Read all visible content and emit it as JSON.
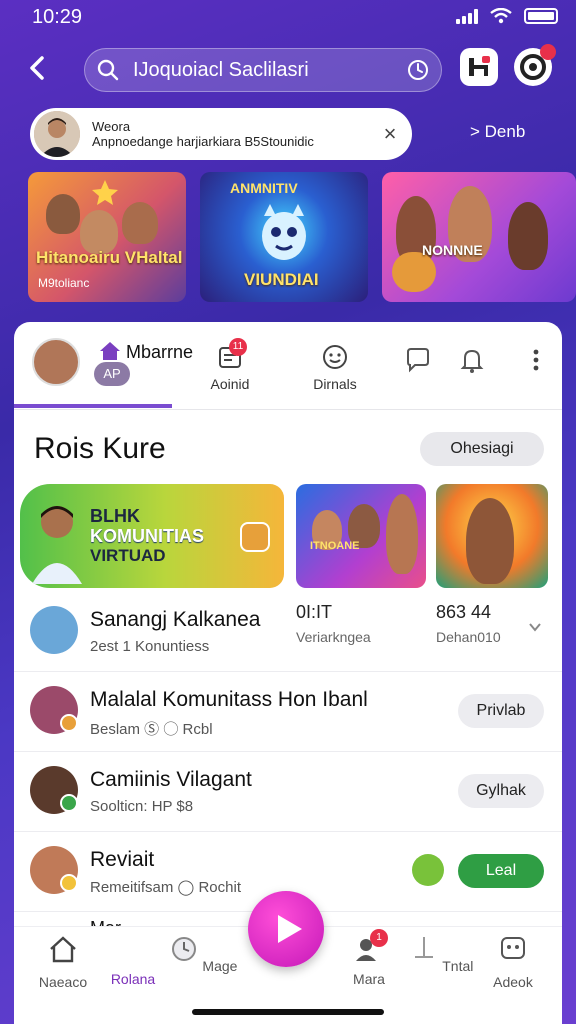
{
  "status": {
    "time": "10:29"
  },
  "search": {
    "query": "IJoquoiacl Saclilasri"
  },
  "notification": {
    "line1": "Weora",
    "line2": "Anpnoedange harjiarkiara B5Stounidic",
    "link": "> Denb"
  },
  "carousel": [
    {
      "label": "Hitanoairu VHaltal",
      "sub": "M9tolianc"
    },
    {
      "label": "VIUNDIAI",
      "title": "ANMNITIV"
    },
    {
      "label": "NONNNE"
    }
  ],
  "profile": {
    "name": "Mbarrne",
    "badge": "AP",
    "tabs": [
      {
        "label": "Aoinid",
        "count": "11"
      },
      {
        "label": "Dirnals"
      }
    ]
  },
  "section": {
    "title": "Rois Kure",
    "action": "Ohesiagi"
  },
  "feature": {
    "title": "BLHK",
    "sub1": "KOMUNITIAS",
    "sub2": "VIRTUAD",
    "small_label": "ITNOANE"
  },
  "list": [
    {
      "title": "Sanangj Kalkanea",
      "sub": "2est 1 Konuntiess",
      "stat1": "0I:IT",
      "stat1_sub": "Veriarkngea",
      "stat2": "863 44",
      "stat2_sub": "Dehan010"
    },
    {
      "title": "Malalal Komunitass Hon Ibanl",
      "sub": "Beslam  Ⓢ  ◯ Rcbl",
      "button": "Privlab"
    },
    {
      "title": "Camiinis Vilagant",
      "sub": "Soolticn: HP $8",
      "button": "Gylhak"
    },
    {
      "title": "Reviait",
      "sub": "Remeitifsam  ◯ Rochit",
      "button": "Leal"
    }
  ],
  "peek": {
    "title": "Mar"
  },
  "nav": [
    {
      "label": "Naeaco"
    },
    {
      "label": "Rolana"
    },
    {
      "label": "Mage"
    },
    {
      "label": "Mara",
      "count": "1"
    },
    {
      "label": "Tntal"
    },
    {
      "label": "Adeok"
    }
  ],
  "colors": {
    "accent": "#7a2fb8",
    "play": "#d41cc4",
    "green": "#2f9e44"
  }
}
